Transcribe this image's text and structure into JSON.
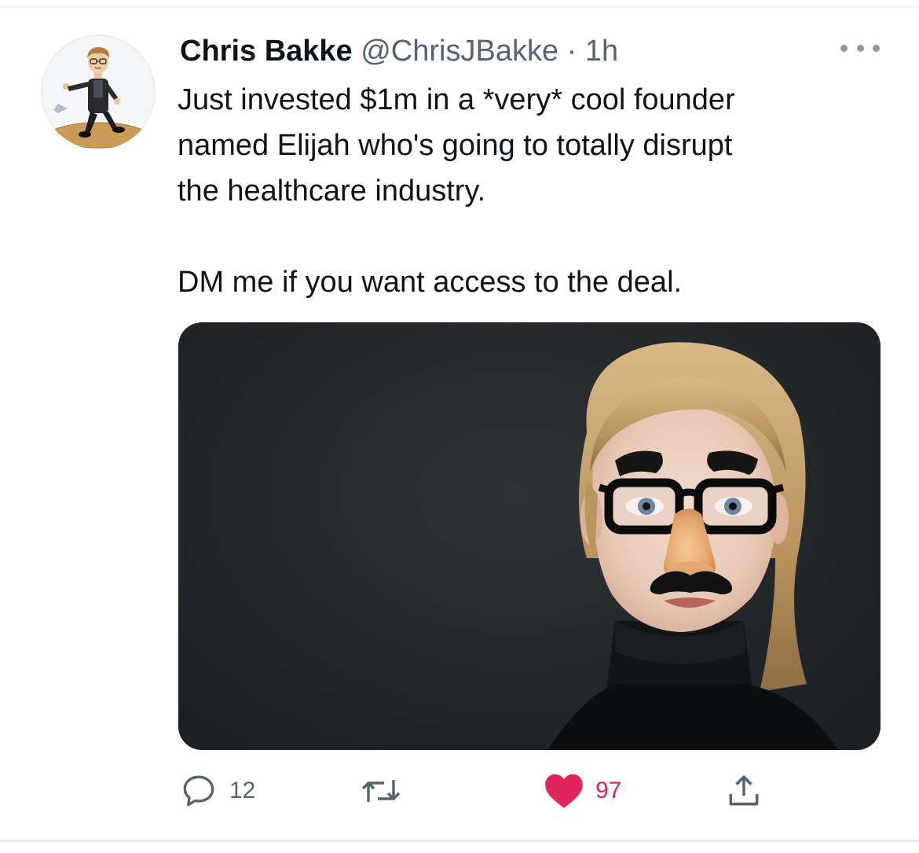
{
  "tweet": {
    "author_name": "Chris Bakke",
    "author_handle": "@ChrisJBakke",
    "separator": "·",
    "timestamp": "1h",
    "text_lines": [
      "Just invested $1m in a *very* cool founder",
      "named Elijah who's going to totally disrupt",
      "the healthcare industry.",
      "DM me if you want access to the deal."
    ],
    "media_description": "Portrait photo of a blonde woman in a black turtleneck wearing novelty glasses, nose and mustache disguise",
    "icons": [
      "more-icon",
      "reply-icon",
      "retweet-icon",
      "like-icon",
      "share-icon"
    ]
  },
  "actions": {
    "reply_count": "12",
    "retweet_count": "",
    "like_count": "97"
  },
  "colors": {
    "text": "#0f1419",
    "secondary": "#536471",
    "like": "#e0245e",
    "divider": "#eff3f4"
  }
}
